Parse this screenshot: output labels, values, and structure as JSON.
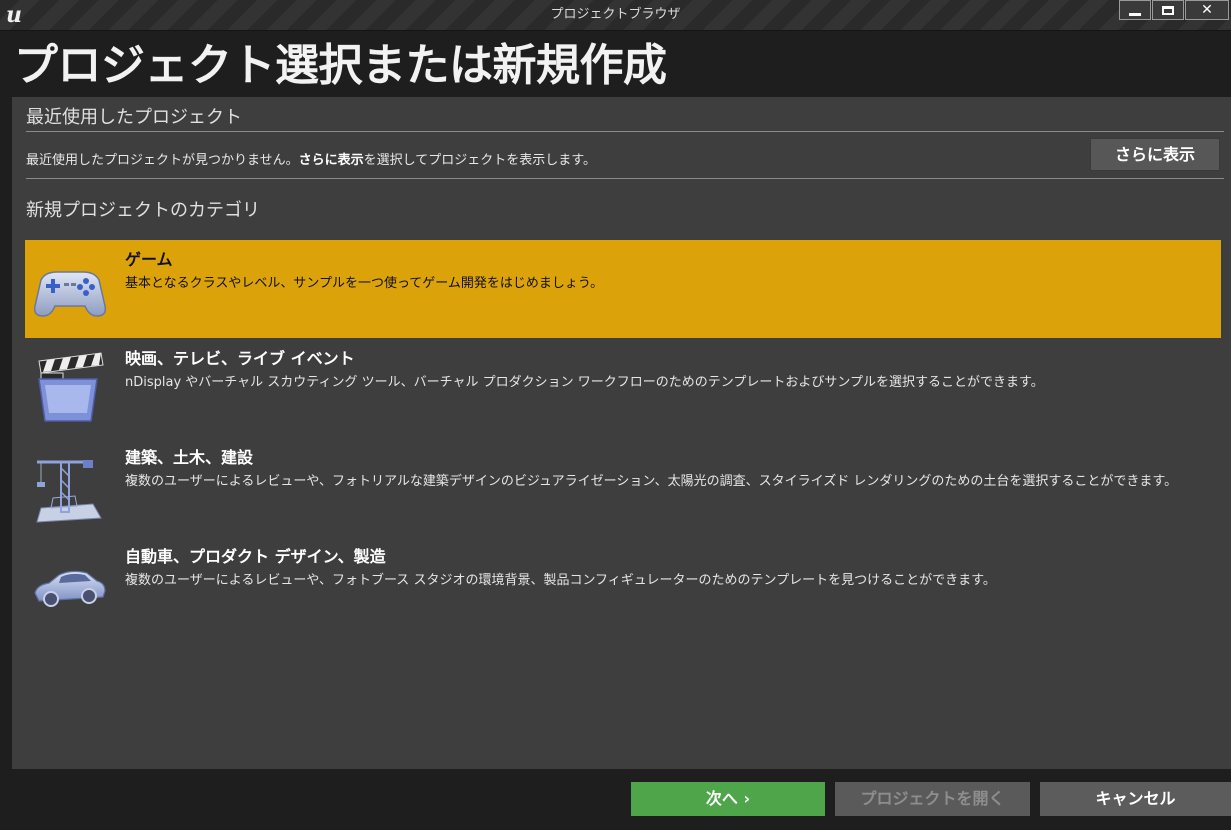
{
  "window": {
    "title": "プロジェクトブラウザ",
    "logo_text": "u"
  },
  "heading": "プロジェクト選択または新規作成",
  "recent": {
    "section_title": "最近使用したプロジェクト",
    "message_prefix": "最近使用したプロジェクトが見つかりません。",
    "message_bold": "さらに表示",
    "message_suffix": "を選択してプロジェクトを表示します。",
    "show_more_label": "さらに表示"
  },
  "categories": {
    "section_title": "新規プロジェクトのカテゴリ",
    "items": [
      {
        "title": "ゲーム",
        "description": "基本となるクラスやレベル、サンプルを一つ使ってゲーム開発をはじめましょう。",
        "icon": "gamepad-icon",
        "selected": true
      },
      {
        "title": "映画、テレビ、ライブ イベント",
        "description": "nDisplay やバーチャル スカウティング ツール、バーチャル プロダクション ワークフローのためのテンプレートおよびサンプルを選択することができます。",
        "icon": "clapperboard-icon",
        "selected": false
      },
      {
        "title": "建築、土木、建設",
        "description": "複数のユーザーによるレビューや、フォトリアルな建築デザインのビジュアライゼーション、太陽光の調査、スタイライズド レンダリングのための土台を選択することができます。",
        "icon": "construction-crane-icon",
        "selected": false
      },
      {
        "title": "自動車、プロダクト デザイン、製造",
        "description": "複数のユーザーによるレビューや、フォトブース スタジオの環境背景、製品コンフィギュレーターのためのテンプレートを見つけることができます。",
        "icon": "car-icon",
        "selected": false
      }
    ]
  },
  "footer": {
    "next_label": "次へ ›",
    "open_label": "プロジェクトを開く",
    "cancel_label": "キャンセル"
  },
  "colors": {
    "selected_category": "#dca20a",
    "next_button": "#4ea54a",
    "panel": "#3e3e3e"
  }
}
